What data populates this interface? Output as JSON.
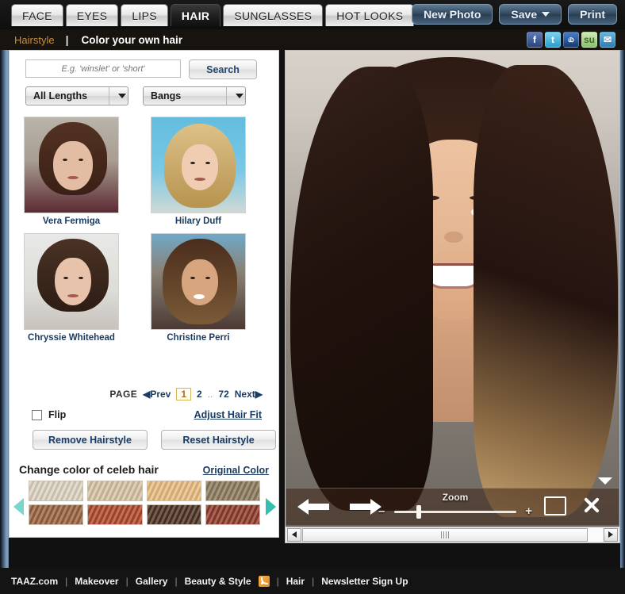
{
  "tabs": [
    {
      "label": "FACE",
      "active": false
    },
    {
      "label": "EYES",
      "active": false
    },
    {
      "label": "LIPS",
      "active": false
    },
    {
      "label": "HAIR",
      "active": true
    },
    {
      "label": "SUNGLASSES",
      "active": false
    },
    {
      "label": "HOT LOOKS",
      "active": false
    }
  ],
  "top_buttons": {
    "new_photo": "New Photo",
    "save": "Save",
    "print": "Print"
  },
  "subnav": {
    "link": "Hairstyle",
    "separator": "|",
    "title": "Color your own hair",
    "socials": [
      {
        "name": "facebook-icon",
        "glyph": "f"
      },
      {
        "name": "twitter-icon",
        "glyph": "t"
      },
      {
        "name": "myspace-icon",
        "glyph": "௰"
      },
      {
        "name": "stumbleupon-icon",
        "glyph": "su"
      },
      {
        "name": "email-icon",
        "glyph": "✉"
      }
    ]
  },
  "search": {
    "placeholder": "E.g. 'winslet' or 'short'",
    "value": "",
    "button_label": "Search"
  },
  "filters": [
    {
      "name": "length-select",
      "value": "All Lengths"
    },
    {
      "name": "bangs-select",
      "value": "Bangs"
    }
  ],
  "thumbnails": [
    {
      "caption": "Vera Fermiga"
    },
    {
      "caption": "Hilary Duff"
    },
    {
      "caption": "Chryssie Whitehead"
    },
    {
      "caption": "Christine Perri"
    }
  ],
  "pagination": {
    "label": "PAGE",
    "prev": "◀Prev",
    "pages": [
      "1",
      "2"
    ],
    "current": "1",
    "dots": "..",
    "last": "72",
    "next": "Next▶"
  },
  "options": {
    "flip_label": "Flip",
    "flip_checked": false,
    "adjust_hair_fit": "Adjust Hair Fit",
    "remove_hairstyle": "Remove Hairstyle",
    "reset_hairstyle": "Reset Hairstyle"
  },
  "color_section": {
    "title": "Change color of celeb hair",
    "original_color": "Original Color",
    "swatches_row1": [
      "#ddd4c2",
      "#d6c3a2",
      "#e8bc82",
      "#8b7a5e"
    ],
    "swatches_row2": [
      "#9a6340",
      "#b0482a",
      "#4d3323",
      "#8e3b2a"
    ]
  },
  "photo_toolbar": {
    "zoom_label": "Zoom",
    "zoom_minus": "–",
    "zoom_plus": "+",
    "zoom_value": 18,
    "back_icon": "arrow-left-icon",
    "forward_icon": "arrow-right-icon",
    "compare_icon": "compare-faces-icon",
    "close_icon": "close-icon",
    "collapse_icon": "collapse-toolbar-icon"
  },
  "footer": {
    "links": [
      "TAAZ.com",
      "Makeover",
      "Gallery",
      "Beauty & Style",
      "Hair",
      "Newsletter Sign Up"
    ],
    "separator": "|",
    "rss_icon": "rss-icon"
  }
}
